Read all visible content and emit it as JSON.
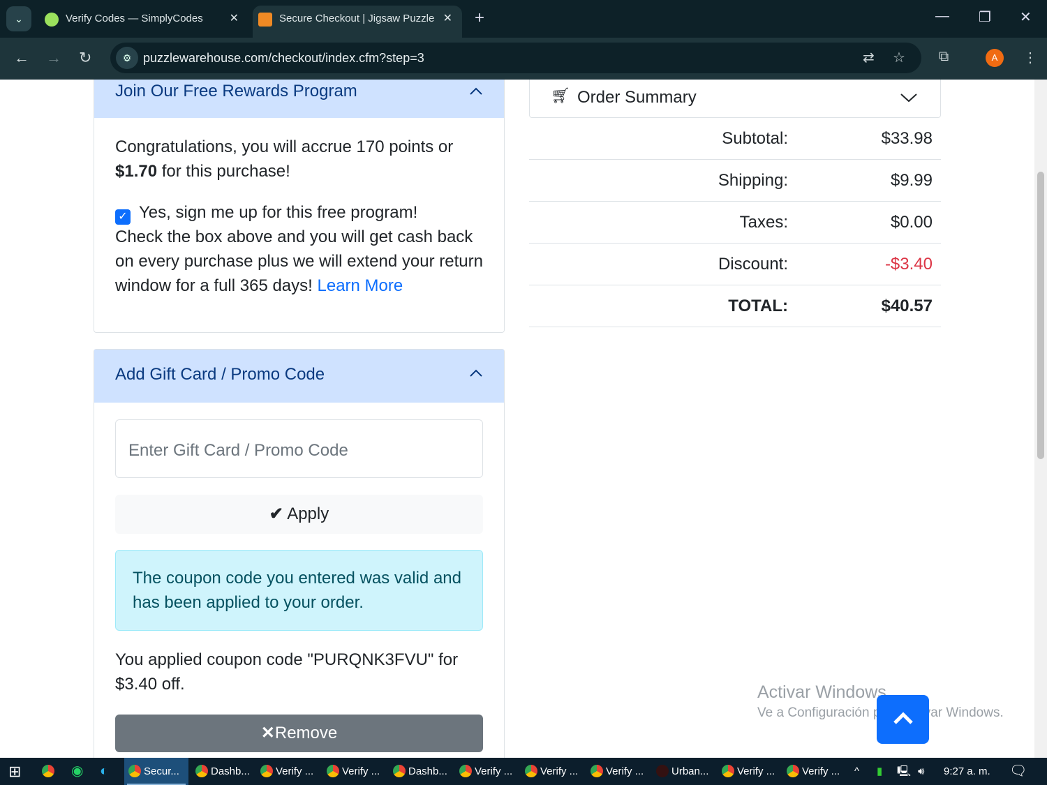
{
  "browser": {
    "tabs": [
      {
        "title": "Verify Codes — SimplyCodes",
        "active": false
      },
      {
        "title": "Secure Checkout | Jigsaw Puzzle",
        "active": true
      }
    ],
    "url": "puzzlewarehouse.com/checkout/index.cfm?step=3",
    "avatar": "A"
  },
  "rewards": {
    "title": "Join Our Free Rewards Program",
    "text1": "Congratulations, you will accrue 170 points or",
    "amount": "$1.70",
    "text2": " for this purchase!",
    "checkbox_label": "Yes, sign me up for this free program!",
    "checked": true,
    "desc": "Check the box above and you will get cash back on every purchase plus we will extend your return window for a full 365 days! ",
    "learn_more": "Learn More"
  },
  "promo": {
    "title": "Add Gift Card / Promo Code",
    "placeholder": "Enter Gift Card / Promo Code",
    "value": "",
    "apply": "Apply",
    "alert": "The coupon code you entered was valid and has been applied to your order.",
    "applied": "You applied coupon code \"PURQNK3FVU\" for $3.40 off.",
    "remove": "Remove"
  },
  "summary": {
    "title": "Order Summary",
    "rows": [
      {
        "label": "Subtotal:",
        "value": "$33.98"
      },
      {
        "label": "Shipping:",
        "value": "$9.99"
      },
      {
        "label": "Taxes:",
        "value": "$0.00"
      },
      {
        "label": "Discount:",
        "value": "-$3.40"
      },
      {
        "label": "TOTAL:",
        "value": "$40.57"
      }
    ],
    "discount_color": "#dc3545"
  },
  "watermark": {
    "line1": "Activar Windows",
    "line2": "Ve a Configuración para activar Windows."
  },
  "taskbar": {
    "items": [
      "Secur...",
      "Dashb...",
      "Verify ...",
      "Verify ...",
      "Dashb...",
      "Verify ...",
      "Verify ...",
      "Verify ...",
      "Urban...",
      "Verify ...",
      "Verify ..."
    ],
    "clock": "9:27 a. m."
  }
}
